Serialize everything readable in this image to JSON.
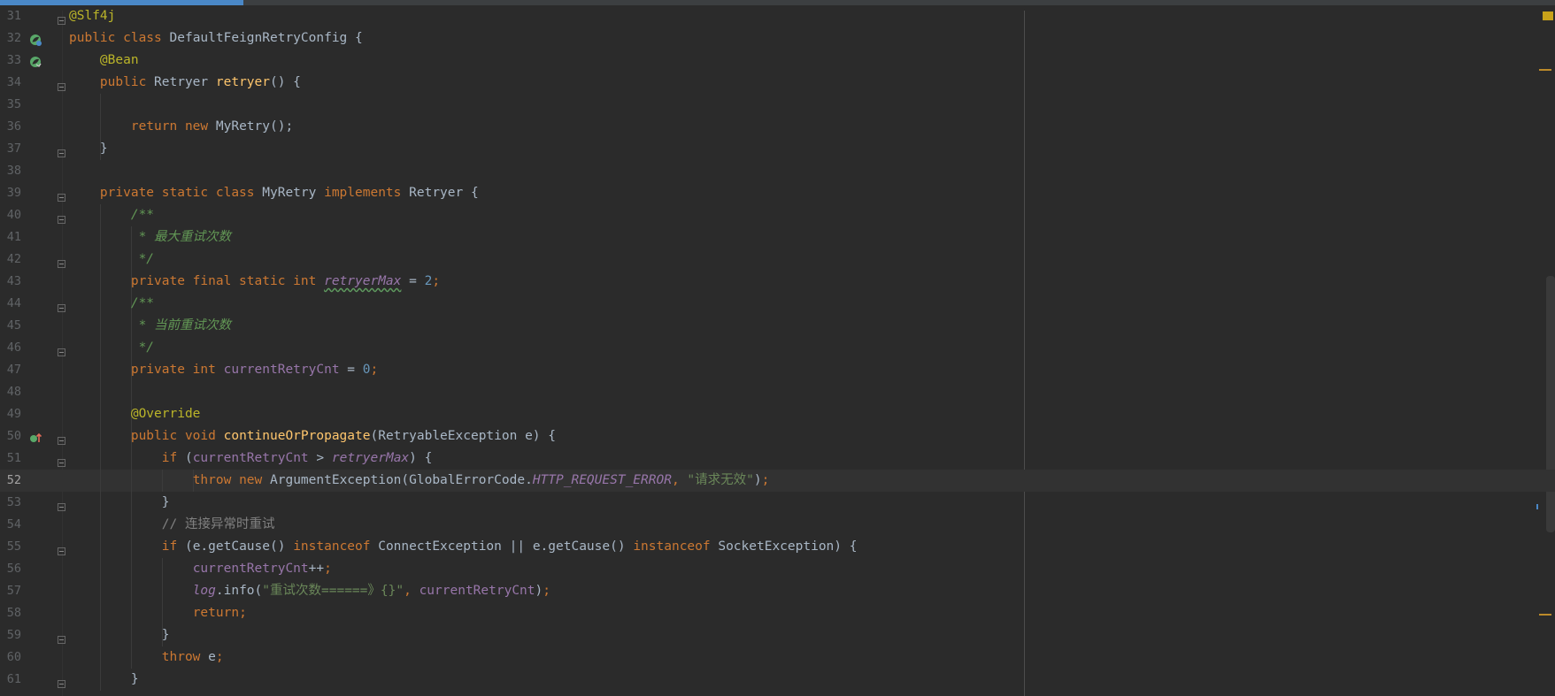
{
  "editor": {
    "current_line": "52",
    "lines": [
      {
        "num": "31",
        "parts": [
          {
            "t": "ann",
            "v": "@Slf4j"
          }
        ]
      },
      {
        "num": "32",
        "parts": [
          {
            "t": "kw",
            "v": "public class "
          },
          {
            "t": "",
            "v": "DefaultFeignRetryConfig {"
          }
        ]
      },
      {
        "num": "33",
        "parts": [
          {
            "t": "",
            "v": "    "
          },
          {
            "t": "ann",
            "v": "@Bean"
          }
        ]
      },
      {
        "num": "34",
        "parts": [
          {
            "t": "",
            "v": "    "
          },
          {
            "t": "kw",
            "v": "public "
          },
          {
            "t": "",
            "v": "Retryer "
          },
          {
            "t": "fn",
            "v": "retryer"
          },
          {
            "t": "",
            "v": "() {"
          }
        ]
      },
      {
        "num": "35",
        "parts": []
      },
      {
        "num": "36",
        "parts": [
          {
            "t": "",
            "v": "        "
          },
          {
            "t": "kw",
            "v": "return new "
          },
          {
            "t": "",
            "v": "MyRetry();"
          }
        ]
      },
      {
        "num": "37",
        "parts": [
          {
            "t": "",
            "v": "    }"
          }
        ]
      },
      {
        "num": "38",
        "parts": []
      },
      {
        "num": "39",
        "parts": [
          {
            "t": "",
            "v": "    "
          },
          {
            "t": "kw",
            "v": "private static class "
          },
          {
            "t": "",
            "v": "MyRetry "
          },
          {
            "t": "kw",
            "v": "implements "
          },
          {
            "t": "",
            "v": "Retryer {"
          }
        ]
      },
      {
        "num": "40",
        "parts": [
          {
            "t": "",
            "v": "        "
          },
          {
            "t": "cmt",
            "v": "/**"
          }
        ]
      },
      {
        "num": "41",
        "parts": [
          {
            "t": "",
            "v": "         "
          },
          {
            "t": "cmt",
            "v": "* 最大重试次数"
          }
        ]
      },
      {
        "num": "42",
        "parts": [
          {
            "t": "",
            "v": "         "
          },
          {
            "t": "cmt",
            "v": "*/"
          }
        ]
      },
      {
        "num": "43",
        "parts": [
          {
            "t": "",
            "v": "        "
          },
          {
            "t": "kw",
            "v": "private final static int "
          },
          {
            "t": "sfld squig",
            "v": "retryerMax"
          },
          {
            "t": "",
            "v": " = "
          },
          {
            "t": "num",
            "v": "2"
          },
          {
            "t": "kw",
            "v": ";"
          }
        ]
      },
      {
        "num": "44",
        "parts": [
          {
            "t": "",
            "v": "        "
          },
          {
            "t": "cmt",
            "v": "/**"
          }
        ]
      },
      {
        "num": "45",
        "parts": [
          {
            "t": "",
            "v": "         "
          },
          {
            "t": "cmt",
            "v": "* 当前重试次数"
          }
        ]
      },
      {
        "num": "46",
        "parts": [
          {
            "t": "",
            "v": "         "
          },
          {
            "t": "cmt",
            "v": "*/"
          }
        ]
      },
      {
        "num": "47",
        "parts": [
          {
            "t": "",
            "v": "        "
          },
          {
            "t": "kw",
            "v": "private int "
          },
          {
            "t": "fld",
            "v": "currentRetryCnt"
          },
          {
            "t": "",
            "v": " = "
          },
          {
            "t": "num",
            "v": "0"
          },
          {
            "t": "kw",
            "v": ";"
          }
        ]
      },
      {
        "num": "48",
        "parts": []
      },
      {
        "num": "49",
        "parts": [
          {
            "t": "",
            "v": "        "
          },
          {
            "t": "ann",
            "v": "@Override"
          }
        ]
      },
      {
        "num": "50",
        "parts": [
          {
            "t": "",
            "v": "        "
          },
          {
            "t": "kw",
            "v": "public void "
          },
          {
            "t": "fn",
            "v": "continueOrPropagate"
          },
          {
            "t": "",
            "v": "(RetryableException e) {"
          }
        ]
      },
      {
        "num": "51",
        "parts": [
          {
            "t": "",
            "v": "            "
          },
          {
            "t": "kw",
            "v": "if "
          },
          {
            "t": "",
            "v": "("
          },
          {
            "t": "fld",
            "v": "currentRetryCnt"
          },
          {
            "t": "",
            "v": " > "
          },
          {
            "t": "sfld",
            "v": "retryerMax"
          },
          {
            "t": "",
            "v": ") {"
          }
        ]
      },
      {
        "num": "52",
        "parts": [
          {
            "t": "",
            "v": "                "
          },
          {
            "t": "kw",
            "v": "throw new "
          },
          {
            "t": "",
            "v": "ArgumentException(GlobalErrorCode."
          },
          {
            "t": "sfld",
            "v": "HTTP_REQUEST_ERROR"
          },
          {
            "t": "kw",
            "v": ", "
          },
          {
            "t": "str",
            "v": "\"请求无效\""
          },
          {
            "t": "",
            "v": ")"
          },
          {
            "t": "kw",
            "v": ";"
          }
        ]
      },
      {
        "num": "53",
        "parts": [
          {
            "t": "",
            "v": "            }"
          }
        ]
      },
      {
        "num": "54",
        "parts": [
          {
            "t": "",
            "v": "            "
          },
          {
            "t": "lcmt",
            "v": "// 连接异常时重试"
          }
        ]
      },
      {
        "num": "55",
        "parts": [
          {
            "t": "",
            "v": "            "
          },
          {
            "t": "kw",
            "v": "if "
          },
          {
            "t": "",
            "v": "(e.getCause() "
          },
          {
            "t": "kw",
            "v": "instanceof "
          },
          {
            "t": "",
            "v": "ConnectException || e.getCause() "
          },
          {
            "t": "kw",
            "v": "instanceof "
          },
          {
            "t": "",
            "v": "SocketException) {"
          }
        ]
      },
      {
        "num": "56",
        "parts": [
          {
            "t": "",
            "v": "                "
          },
          {
            "t": "fld",
            "v": "currentRetryCnt"
          },
          {
            "t": "",
            "v": "++"
          },
          {
            "t": "kw",
            "v": ";"
          }
        ]
      },
      {
        "num": "57",
        "parts": [
          {
            "t": "",
            "v": "                "
          },
          {
            "t": "sfld",
            "v": "log"
          },
          {
            "t": "",
            "v": ".info("
          },
          {
            "t": "str",
            "v": "\"重试次数======》{}\""
          },
          {
            "t": "kw",
            "v": ", "
          },
          {
            "t": "fld",
            "v": "currentRetryCnt"
          },
          {
            "t": "",
            "v": ")"
          },
          {
            "t": "kw",
            "v": ";"
          }
        ]
      },
      {
        "num": "58",
        "parts": [
          {
            "t": "",
            "v": "                "
          },
          {
            "t": "kw",
            "v": "return;"
          }
        ]
      },
      {
        "num": "59",
        "parts": [
          {
            "t": "",
            "v": "            }"
          }
        ]
      },
      {
        "num": "60",
        "parts": [
          {
            "t": "",
            "v": "            "
          },
          {
            "t": "kw",
            "v": "throw "
          },
          {
            "t": "",
            "v": "e"
          },
          {
            "t": "kw",
            "v": ";"
          }
        ]
      },
      {
        "num": "61",
        "parts": [
          {
            "t": "",
            "v": "        }"
          }
        ]
      }
    ],
    "gutter_icons": {
      "32": "bean-class-icon",
      "33": "bean-method-icon",
      "50": "override-method-icon"
    },
    "fold_lines": [
      "31",
      "34",
      "37",
      "39",
      "40",
      "42",
      "44",
      "46",
      "50",
      "51",
      "53",
      "55",
      "59",
      "61"
    ]
  },
  "colors": {
    "background": "#2b2b2b",
    "keyword": "#cc7832",
    "annotation": "#bbb529",
    "function": "#ffc66d",
    "number": "#6897bb",
    "string": "#6a8759",
    "doc_comment": "#629755",
    "field": "#9876aa",
    "text": "#a9b7c6"
  }
}
